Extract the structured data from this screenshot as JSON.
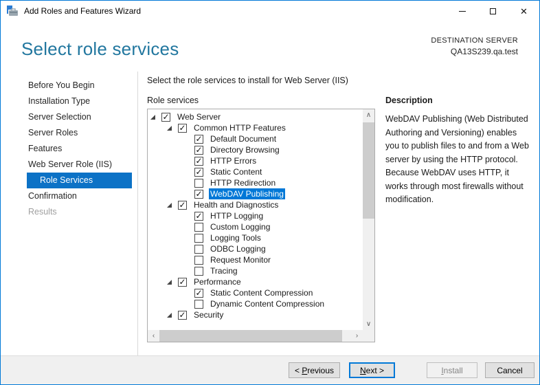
{
  "window": {
    "title": "Add Roles and Features Wizard"
  },
  "header": {
    "title": "Select role services",
    "destination_label": "DESTINATION SERVER",
    "destination_server": "QA13S239.qa.test"
  },
  "sidebar": {
    "items": [
      {
        "label": "Before You Begin",
        "state": "normal"
      },
      {
        "label": "Installation Type",
        "state": "normal"
      },
      {
        "label": "Server Selection",
        "state": "normal"
      },
      {
        "label": "Server Roles",
        "state": "normal"
      },
      {
        "label": "Features",
        "state": "normal"
      },
      {
        "label": "Web Server Role (IIS)",
        "state": "normal"
      },
      {
        "label": "Role Services",
        "state": "selected"
      },
      {
        "label": "Confirmation",
        "state": "normal"
      },
      {
        "label": "Results",
        "state": "disabled"
      }
    ]
  },
  "main": {
    "instruction": "Select the role services to install for Web Server (IIS)",
    "list_label": "Role services",
    "tree": [
      {
        "level": 0,
        "label": "Web Server",
        "checked": true,
        "expander": true
      },
      {
        "level": 1,
        "label": "Common HTTP Features",
        "checked": true,
        "expander": true
      },
      {
        "level": 2,
        "label": "Default Document",
        "checked": true
      },
      {
        "level": 2,
        "label": "Directory Browsing",
        "checked": true
      },
      {
        "level": 2,
        "label": "HTTP Errors",
        "checked": true
      },
      {
        "level": 2,
        "label": "Static Content",
        "checked": true
      },
      {
        "level": 2,
        "label": "HTTP Redirection",
        "checked": false
      },
      {
        "level": 2,
        "label": "WebDAV Publishing",
        "checked": true,
        "selected": true
      },
      {
        "level": 1,
        "label": "Health and Diagnostics",
        "checked": true,
        "expander": true
      },
      {
        "level": 2,
        "label": "HTTP Logging",
        "checked": true
      },
      {
        "level": 2,
        "label": "Custom Logging",
        "checked": false
      },
      {
        "level": 2,
        "label": "Logging Tools",
        "checked": false
      },
      {
        "level": 2,
        "label": "ODBC Logging",
        "checked": false
      },
      {
        "level": 2,
        "label": "Request Monitor",
        "checked": false
      },
      {
        "level": 2,
        "label": "Tracing",
        "checked": false
      },
      {
        "level": 1,
        "label": "Performance",
        "checked": true,
        "expander": true
      },
      {
        "level": 2,
        "label": "Static Content Compression",
        "checked": true
      },
      {
        "level": 2,
        "label": "Dynamic Content Compression",
        "checked": false
      },
      {
        "level": 1,
        "label": "Security",
        "checked": true,
        "expander": true
      }
    ]
  },
  "description": {
    "heading": "Description",
    "text": "WebDAV Publishing (Web Distributed Authoring and Versioning) enables you to publish files to and from a Web server by using the HTTP protocol. Because WebDAV uses HTTP, it works through most firewalls without modification."
  },
  "buttons": [
    {
      "name": "previous-button",
      "pre": "< ",
      "key": "P",
      "post": "revious",
      "state": "normal"
    },
    {
      "name": "next-button",
      "pre": "",
      "key": "N",
      "post": "ext >",
      "state": "default"
    },
    {
      "name": "install-button",
      "pre": "",
      "key": "I",
      "post": "nstall",
      "state": "disabled"
    },
    {
      "name": "cancel-button",
      "pre": "",
      "key": "",
      "post": "Cancel",
      "state": "normal"
    }
  ],
  "icons": {
    "close": "✕",
    "scroll_up": "∧",
    "scroll_down": "∨",
    "scroll_left": "‹",
    "scroll_right": "›",
    "check": "✓"
  },
  "colors": {
    "accent": "#0078d7",
    "heading": "#22779f",
    "sidebar_selected": "#0c72c6",
    "selection": "#0078d7"
  }
}
